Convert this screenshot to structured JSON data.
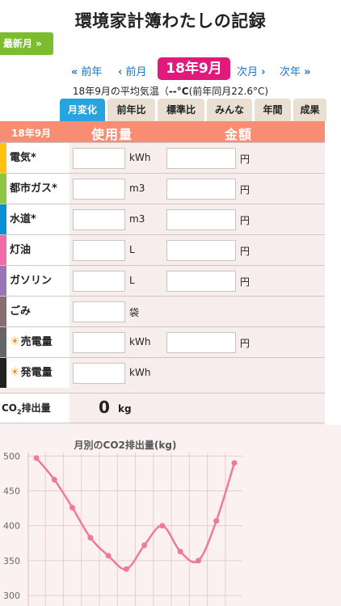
{
  "header": {
    "title": "環境家計簿わたしの記録",
    "latest_label": "最新月 »"
  },
  "nav": {
    "prev_year": "前年",
    "prev_month": "前月",
    "current": "18年9月",
    "next_month": "次月",
    "next_year": "次年"
  },
  "temperature": {
    "prefix": "18年9月の平均気温（",
    "value": "--°C",
    "suffix": "(前年同月22.6°C)"
  },
  "tabs": [
    {
      "label": "月変化",
      "active": true
    },
    {
      "label": "前年比",
      "active": false
    },
    {
      "label": "標準比",
      "active": false
    },
    {
      "label": "みんな",
      "active": false
    },
    {
      "label": "年間",
      "active": false
    },
    {
      "label": "成果",
      "active": false
    }
  ],
  "table": {
    "month": "18年9月",
    "usage_header": "使用量",
    "amount_header": "金額",
    "yen": "円",
    "rows": [
      {
        "label": "電気*",
        "unit": "kWh",
        "color": "#ffc20e",
        "usage": "",
        "amount": ""
      },
      {
        "label": "都市ガス*",
        "unit": "m3",
        "color": "#8dc63f",
        "usage": "",
        "amount": ""
      },
      {
        "label": "水道*",
        "unit": "m3",
        "color": "#0b8fd4",
        "usage": "",
        "amount": ""
      },
      {
        "label": "灯油",
        "unit": "L",
        "color": "#f06ba6",
        "usage": "",
        "amount": ""
      },
      {
        "label": "ガソリン",
        "unit": "L",
        "color": "#9a74b5",
        "usage": "",
        "amount": ""
      },
      {
        "label": "ごみ",
        "unit": "袋",
        "color": "#8a6d70",
        "usage": ""
      },
      {
        "label": "売電量",
        "unit": "kWh",
        "color": "#666666",
        "usage": "",
        "amount": "",
        "icon": "sun-icon"
      },
      {
        "label": "発電量",
        "unit": "kWh",
        "color": "#222222",
        "usage": "",
        "icon": "sun-icon"
      }
    ],
    "co2": {
      "label_pre": "CO",
      "label_sub": "2",
      "label_post": "排出量",
      "value": "0",
      "unit": "kg"
    }
  },
  "chart_data": {
    "type": "line",
    "title": "月別のCO2排出量(kg)",
    "yticks": [
      300,
      350,
      400,
      450,
      500
    ],
    "ylim": [
      285,
      505
    ],
    "line_color": "#ee7b96",
    "values": [
      497,
      466,
      426,
      383,
      357,
      338,
      372,
      400,
      363,
      350,
      407,
      490
    ]
  }
}
